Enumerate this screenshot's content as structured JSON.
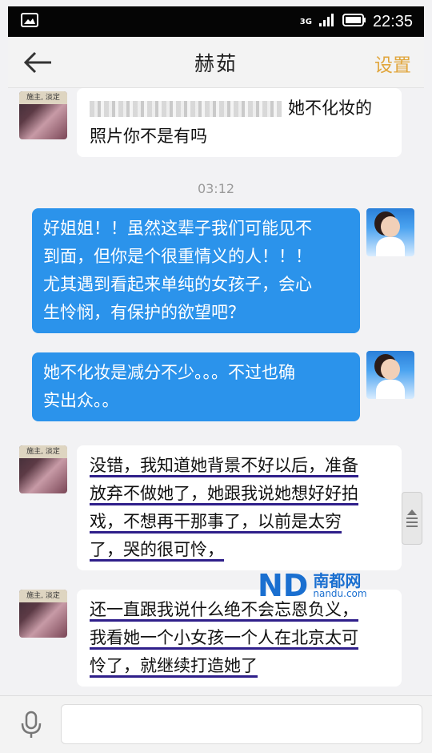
{
  "status_bar": {
    "time": "22:35",
    "network": "3G",
    "icons": [
      "image-icon",
      "signal-icon",
      "battery-icon"
    ]
  },
  "header": {
    "title": "赫茹",
    "settings_label": "设置",
    "icons": [
      "back-arrow-icon"
    ]
  },
  "messages": [
    {
      "side": "left",
      "lines": [
        "她不化妆的",
        "照片你不是有吗"
      ]
    },
    {
      "side": "right",
      "lines": [
        "好姐姐！！虽然这辈子我们可能见不",
        "到面，但你是个很重情义的人！！！",
        "尤其遇到看起来单纯的女孩子，会心",
        "生怜悯，有保护的欲望吧？"
      ]
    },
    {
      "side": "right",
      "lines": [
        "她不化妆是减分不少。。。不过也确",
        "实出众。。"
      ]
    },
    {
      "side": "left",
      "lines": [
        "没错，我知道她背景不好以后，准备",
        "放弃不做她了，她跟我说她想好好拍",
        "戏，不想再干那事了，以前是太穷",
        "了，哭的很可怜，"
      ]
    },
    {
      "side": "left",
      "lines": [
        "还一直跟我说什么绝不会忘恩负义，",
        "我看她一个小女孩一个人在北京太可",
        "怜了，就继续打造她了"
      ]
    }
  ],
  "timestamp": "03:12",
  "avatar_caption": "施主, 淡定",
  "watermark": {
    "logo": "ND",
    "name": "南都网",
    "url": "nandu.com"
  },
  "input_bar": {
    "icons": [
      "microphone-icon"
    ]
  },
  "colors": {
    "accent": "#e1a63d",
    "bubble_blue": "#2b93eb",
    "underline": "#2f1f8a",
    "watermark_blue": "#1a6fd0"
  }
}
